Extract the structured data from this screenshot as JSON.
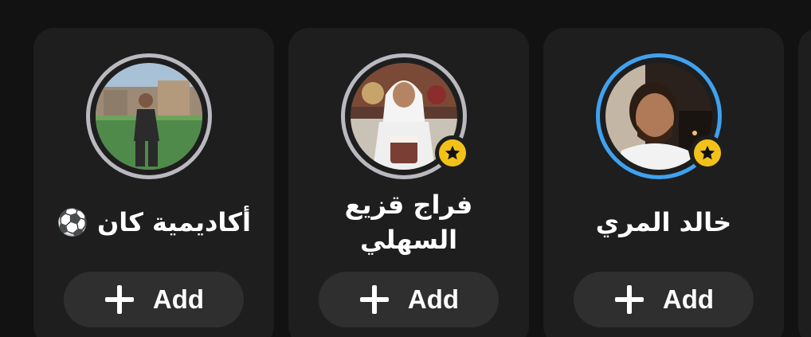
{
  "theme": {
    "background": "#121212",
    "card": "#1e1e1e",
    "button": "#2f2f2f",
    "ring_gray": "#b9b9bf",
    "ring_blue": "#3fa2f0",
    "star_badge": "#f2c21a"
  },
  "suggestions": [
    {
      "name": "أكاديمية كان ⚽️",
      "ring": "gray",
      "star": false,
      "add_label": "Add",
      "add_icon": "plus-icon"
    },
    {
      "name": "فراج قزيع السهلي",
      "ring": "gray",
      "star": true,
      "add_label": "Add",
      "add_icon": "plus-icon"
    },
    {
      "name": "خالد المري",
      "ring": "blue",
      "star": true,
      "add_label": "Add",
      "add_icon": "plus-icon"
    }
  ]
}
